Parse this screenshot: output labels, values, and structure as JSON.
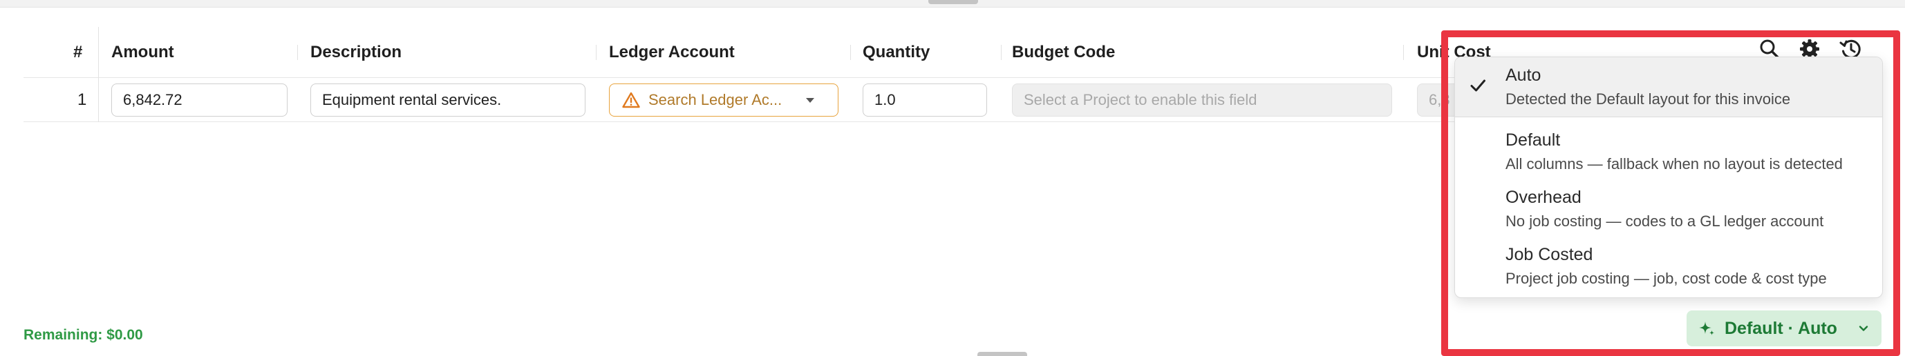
{
  "columns": {
    "number": "#",
    "amount": "Amount",
    "description": "Description",
    "ledger": "Ledger Account",
    "quantity": "Quantity",
    "budget": "Budget Code",
    "unit_cost": "Unit Cost"
  },
  "row": {
    "number": "1",
    "amount": "6,842.72",
    "description": "Equipment rental services.",
    "ledger_placeholder": "Search Ledger Ac...",
    "quantity": "1.0",
    "budget_placeholder": "Select a Project to enable this field",
    "unit_cost_partial": "6,8"
  },
  "footer": {
    "remaining": "Remaining: $0.00"
  },
  "layout_button": {
    "label": "Default · Auto"
  },
  "layout_menu": {
    "items": [
      {
        "label": "Auto",
        "description": "Detected the Default layout for this invoice",
        "selected": true
      },
      {
        "label": "Default",
        "description": "All columns — fallback when no layout is detected",
        "selected": false
      },
      {
        "label": "Overhead",
        "description": "No job costing — codes to a GL ledger account",
        "selected": false
      },
      {
        "label": "Job Costed",
        "description": "Project job costing — job, cost code & cost type",
        "selected": false
      }
    ]
  },
  "icons": [
    "search-icon",
    "gear-icon",
    "history-icon",
    "warning-icon",
    "chevron-down-icon",
    "check-icon",
    "sparkle-icon"
  ],
  "colors": {
    "warning": "#e8a33c",
    "success_text": "#2f9a45",
    "layout_button_bg": "#d7efdc",
    "highlight": "#ea3541"
  }
}
